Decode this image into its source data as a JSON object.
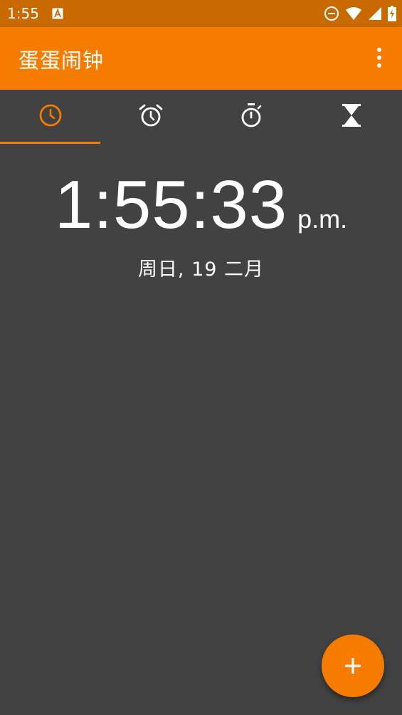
{
  "status_bar": {
    "time": "1:55",
    "notification_icon": "a-icon",
    "icons": [
      "do-not-disturb-icon",
      "wifi-icon",
      "signal-icon",
      "battery-charging-icon"
    ]
  },
  "app_bar": {
    "title": "蛋蛋闹钟",
    "overflow_icon": "more-vert-icon"
  },
  "tabs": [
    {
      "icon": "clock-icon",
      "active": true
    },
    {
      "icon": "alarm-icon",
      "active": false
    },
    {
      "icon": "stopwatch-icon",
      "active": false
    },
    {
      "icon": "hourglass-icon",
      "active": false
    }
  ],
  "clock": {
    "time": "1:55:33",
    "ampm": "p.m.",
    "date": "周日, 19 二月"
  },
  "fab": {
    "icon": "plus-icon"
  },
  "colors": {
    "accent": "#f57c00",
    "status_bar": "#c96a00",
    "background": "#424242"
  }
}
